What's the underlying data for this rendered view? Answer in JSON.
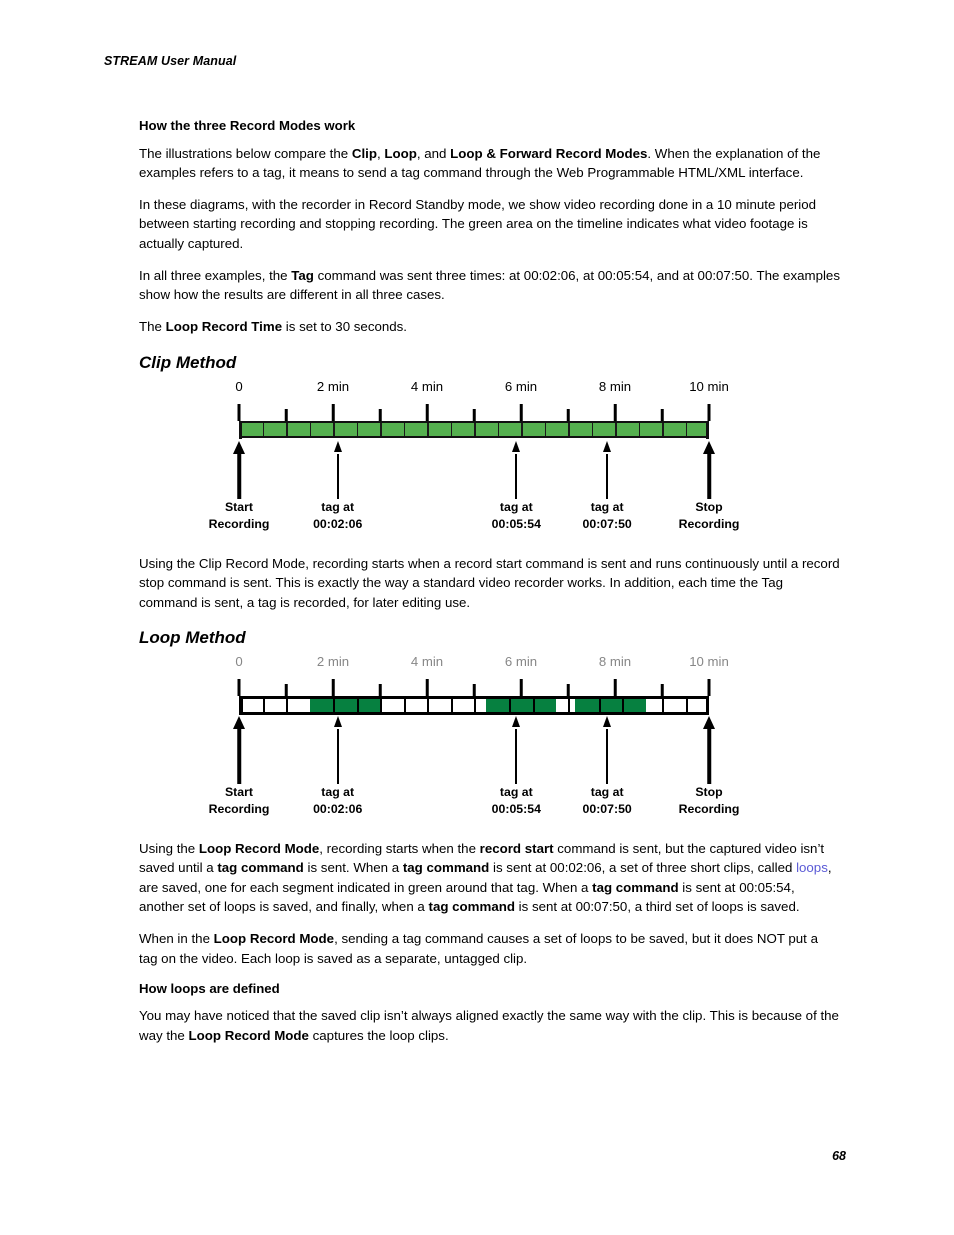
{
  "document": {
    "running_header": "STREAM User Manual",
    "page_number": "68"
  },
  "sections": {
    "record_modes_heading": "How the three Record Modes work",
    "paragraph_1": {
      "part_1": "The illustrations below compare the ",
      "bold_1": "Clip",
      "part_2": ", ",
      "bold_2": "Loop",
      "part_3": ", and ",
      "bold_3": "Loop & Forward Record Modes",
      "part_4": ". When the explanation of the examples refers to a tag, it means to send a tag command through the Web Programmable HTML/XML interface."
    },
    "paragraph_2": "In these diagrams, with the recorder in Record Standby mode, we show video recording done in a 10 minute period between starting recording and stopping recording. The green area on the timeline indicates what video footage is actually captured.",
    "paragraph_3": {
      "part_1": "In all three examples, the ",
      "bold_1": "Tag",
      "part_2": " command was sent three times: at 00:02:06, at 00:05:54, and at 00:07:50. The examples show how the results are different in all three cases."
    },
    "paragraph_4": {
      "part_1": "The ",
      "bold_1": "Loop Record Time",
      "part_2": " is set to 30 seconds."
    },
    "clip_method_heading": "Clip Method",
    "clip_explanation": "Using the Clip Record Mode, recording starts when a record start command is sent and runs continuously until a record stop command is sent. This is exactly the way a standard video recorder works. In addition, each time the Tag command is sent, a tag is recorded, for later editing use.",
    "loop_method_heading": "Loop Method",
    "loop_explanation": {
      "part_1": "Using the ",
      "bold_1": "Loop Record Mode",
      "part_2": ", recording starts when the ",
      "bold_2": "record start",
      "part_3": " command is sent, but the captured video isn’t saved until a ",
      "bold_3": "tag command",
      "part_4": " is sent. When a ",
      "bold_4": "tag command",
      "part_5": " is sent at 00:02:06, a set of three short clips, called ",
      "link_1": "loops",
      "part_6": ", are saved, one for each segment indicated in green around that tag. When a ",
      "bold_5": "tag command",
      "part_7": " is sent at 00:05:54, another set of loops is saved, and finally, when a ",
      "bold_6": "tag command",
      "part_8": " is sent at 00:07:50, a third set of loops is saved."
    },
    "loop_note": {
      "part_1": "When in the ",
      "bold_1": "Loop Record Mode",
      "part_2": ", sending a tag command causes a set of loops to be saved, but it does NOT put a tag on the video. Each loop is saved as a separate, untagged clip."
    },
    "how_loops_heading": "How loops are defined",
    "how_loops_paragraph": {
      "part_1": "You may have noticed that the saved clip isn’t always aligned exactly the same way with the clip. This is because of the way the ",
      "bold_1": "Loop Record Mode",
      "part_2": " captures the loop clips."
    }
  },
  "chart_data": [
    {
      "type": "timeline",
      "title": "Clip Method",
      "xlabel": "",
      "xlim": [
        0,
        10
      ],
      "unit": "min",
      "tick_labels": [
        "0",
        "2 min",
        "4 min",
        "6 min",
        "8 min",
        "10 min"
      ],
      "tick_values": [
        0,
        2,
        4,
        6,
        8,
        10
      ],
      "minor_tick_values": [
        1,
        3,
        5,
        7,
        9
      ],
      "tick_label_color": "#000000",
      "bar": {
        "style": "continuous",
        "color": "#55b04f",
        "outline": "#111111",
        "span": [
          0,
          10
        ],
        "segment_divisions": [
          0.5,
          1.0,
          1.5,
          2.0,
          2.5,
          3.0,
          3.5,
          4.0,
          4.5,
          5.0,
          5.5,
          6.0,
          6.5,
          7.0,
          7.5,
          8.0,
          8.5,
          9.0,
          9.5
        ]
      },
      "markers": [
        {
          "value": 0,
          "label_line1": "Start",
          "label_line2": "Recording",
          "weight": "thick"
        },
        {
          "value": 2.1,
          "label_line1": "tag at",
          "label_line2": "00:02:06",
          "weight": "thin"
        },
        {
          "value": 5.9,
          "label_line1": "tag at",
          "label_line2": "00:05:54",
          "weight": "thin"
        },
        {
          "value": 7.833,
          "label_line1": "tag at",
          "label_line2": "00:07:50",
          "weight": "thin"
        },
        {
          "value": 10,
          "label_line1": "Stop",
          "label_line2": "Recording",
          "weight": "thick"
        }
      ]
    },
    {
      "type": "timeline",
      "title": "Loop Method",
      "xlabel": "",
      "xlim": [
        0,
        10
      ],
      "unit": "min",
      "tick_labels": [
        "0",
        "2 min",
        "4 min",
        "6 min",
        "8 min",
        "10 min"
      ],
      "tick_values": [
        0,
        2,
        4,
        6,
        8,
        10
      ],
      "minor_tick_values": [
        1,
        3,
        5,
        7,
        9
      ],
      "tick_label_color": "#878787",
      "bar": {
        "style": "segmented",
        "background": "#ffffff",
        "clip_color": "#068040",
        "outline": "#000000",
        "span": [
          0,
          10
        ],
        "segment_divisions": [
          0.5,
          1.0,
          1.5,
          2.0,
          2.5,
          3.0,
          3.5,
          4.0,
          4.5,
          5.0,
          5.5,
          6.0,
          6.5,
          7.0,
          7.5,
          8.0,
          8.5,
          9.0,
          9.5
        ],
        "saved_clip_groups": [
          {
            "start": 1.5,
            "end": 3.0,
            "clips": 3
          },
          {
            "start": 5.25,
            "end": 6.75,
            "clips": 3
          },
          {
            "start": 7.15,
            "end": 8.65,
            "clips": 3
          }
        ]
      },
      "markers": [
        {
          "value": 0,
          "label_line1": "Start",
          "label_line2": "Recording",
          "weight": "thick"
        },
        {
          "value": 2.1,
          "label_line1": "tag at",
          "label_line2": "00:02:06",
          "weight": "thin"
        },
        {
          "value": 5.9,
          "label_line1": "tag at",
          "label_line2": "00:05:54",
          "weight": "thin"
        },
        {
          "value": 7.833,
          "label_line1": "tag at",
          "label_line2": "00:07:50",
          "weight": "thin"
        },
        {
          "value": 10,
          "label_line1": "Stop",
          "label_line2": "Recording",
          "weight": "thick"
        }
      ]
    }
  ]
}
